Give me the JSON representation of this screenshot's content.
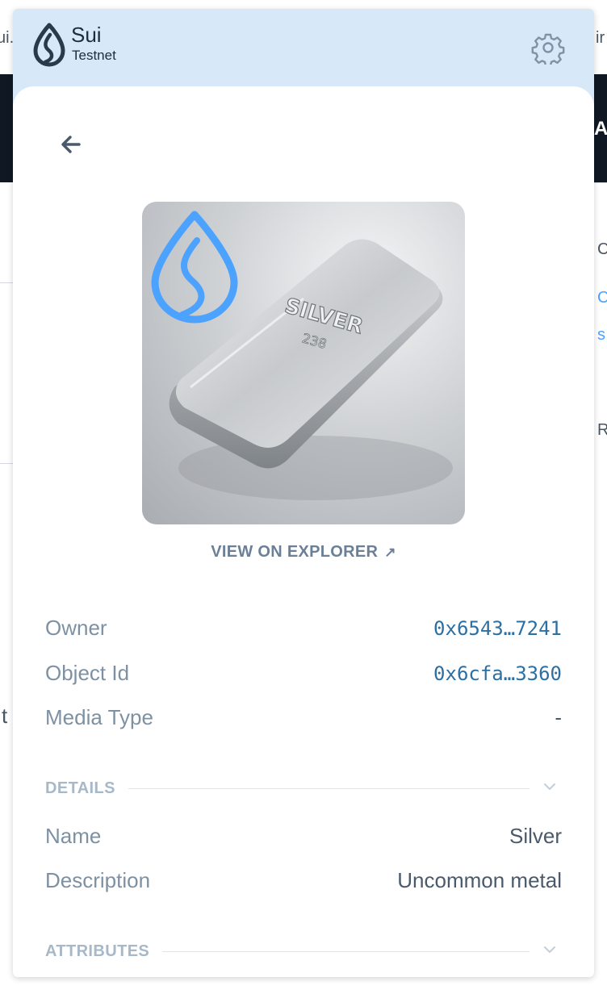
{
  "app": {
    "brand": "Sui",
    "network": "Testnet"
  },
  "background_fragments": {
    "top_left": "ui.",
    "top_right": "ir",
    "dark_right": "A",
    "right_1": "C",
    "right_2": "C",
    "right_3": "s",
    "right_4": "R",
    "left_mid": "t"
  },
  "nft": {
    "image_alt": "Silver bar",
    "bar_text": "SILVER",
    "bar_number": "238",
    "explorer_link": "VIEW ON EXPLORER",
    "explorer_arrow": "↗"
  },
  "info_rows": [
    {
      "label": "Owner",
      "value": "0x6543…7241"
    },
    {
      "label": "Object Id",
      "value": "0x6cfa…3360"
    },
    {
      "label": "Media Type",
      "value": "-"
    }
  ],
  "details": {
    "title": "DETAILS",
    "rows": [
      {
        "label": "Name",
        "value": "Silver"
      },
      {
        "label": "Description",
        "value": "Uncommon metal"
      }
    ]
  },
  "attributes": {
    "title": "ATTRIBUTES"
  },
  "colors": {
    "header_bg": "#d7e9f8",
    "sui_blue": "#4ca2ff",
    "link_mono": "#2c6fa3",
    "label_gray": "#7d91a3"
  },
  "icons": {
    "logo": "sui-drop-logo",
    "settings": "gear-icon",
    "back": "arrow-left-icon",
    "external": "arrow-up-right-icon",
    "chevron": "chevron-down-icon"
  }
}
